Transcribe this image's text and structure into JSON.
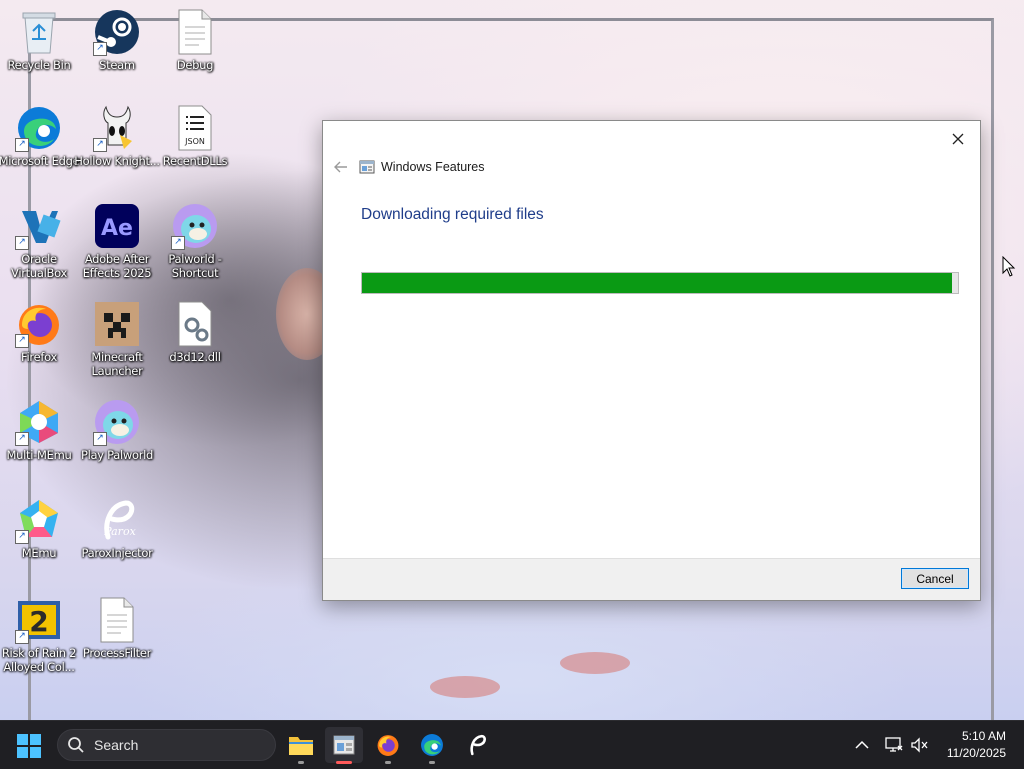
{
  "desktop": {
    "icons": [
      {
        "label": "Recycle Bin",
        "icon": "recycle-bin-icon"
      },
      {
        "label": "Steam",
        "icon": "steam-icon"
      },
      {
        "label": "Debug",
        "icon": "document-icon"
      },
      {
        "label": "Microsoft Edge",
        "icon": "edge-icon"
      },
      {
        "label": "Hollow Knight...",
        "icon": "hollow-knight-icon"
      },
      {
        "label": "RecentDLLs",
        "icon": "json-file-icon",
        "badge": "JSON"
      },
      {
        "label": "Oracle VirtualBox",
        "icon": "virtualbox-icon"
      },
      {
        "label": "Adobe After Effects 2025",
        "icon": "after-effects-icon",
        "badge": "Ae"
      },
      {
        "label": "Palworld - Shortcut",
        "icon": "palworld-icon"
      },
      {
        "label": "Firefox",
        "icon": "firefox-icon"
      },
      {
        "label": "Minecraft Launcher",
        "icon": "minecraft-icon"
      },
      {
        "label": "d3d12.dll",
        "icon": "dll-file-icon"
      },
      {
        "label": "Multi-MEmu",
        "icon": "multi-memu-icon"
      },
      {
        "label": "Play Palworld",
        "icon": "palworld-icon"
      },
      {
        "label": "MEmu",
        "icon": "memu-icon"
      },
      {
        "label": "ParoxInjector",
        "icon": "parox-icon",
        "badge": "Parox"
      },
      {
        "label": "Risk of Rain 2 Alloyed Col...",
        "icon": "risk-of-rain-icon"
      },
      {
        "label": "ProcessFilter",
        "icon": "document-icon"
      }
    ]
  },
  "dialog": {
    "title": "Windows Features",
    "heading": "Downloading required files",
    "progress": 0.99,
    "cancel_label": "Cancel"
  },
  "taskbar": {
    "search_label": "Search",
    "apps": [
      {
        "name": "File Explorer",
        "icon": "folder-icon"
      },
      {
        "name": "Windows Features",
        "icon": "windows-features-icon",
        "active": true
      },
      {
        "name": "Firefox",
        "icon": "firefox-icon"
      },
      {
        "name": "Microsoft Edge",
        "icon": "edge-icon"
      },
      {
        "name": "ParoxInjector",
        "icon": "parox-icon"
      }
    ],
    "time": "5:10 AM",
    "date": "11/20/2025"
  },
  "colors": {
    "progress_fill": "#0a9a14",
    "heading_blue": "#1f3d8a",
    "taskbar_bg": "#1f1f23",
    "accent": "#0078d7"
  }
}
